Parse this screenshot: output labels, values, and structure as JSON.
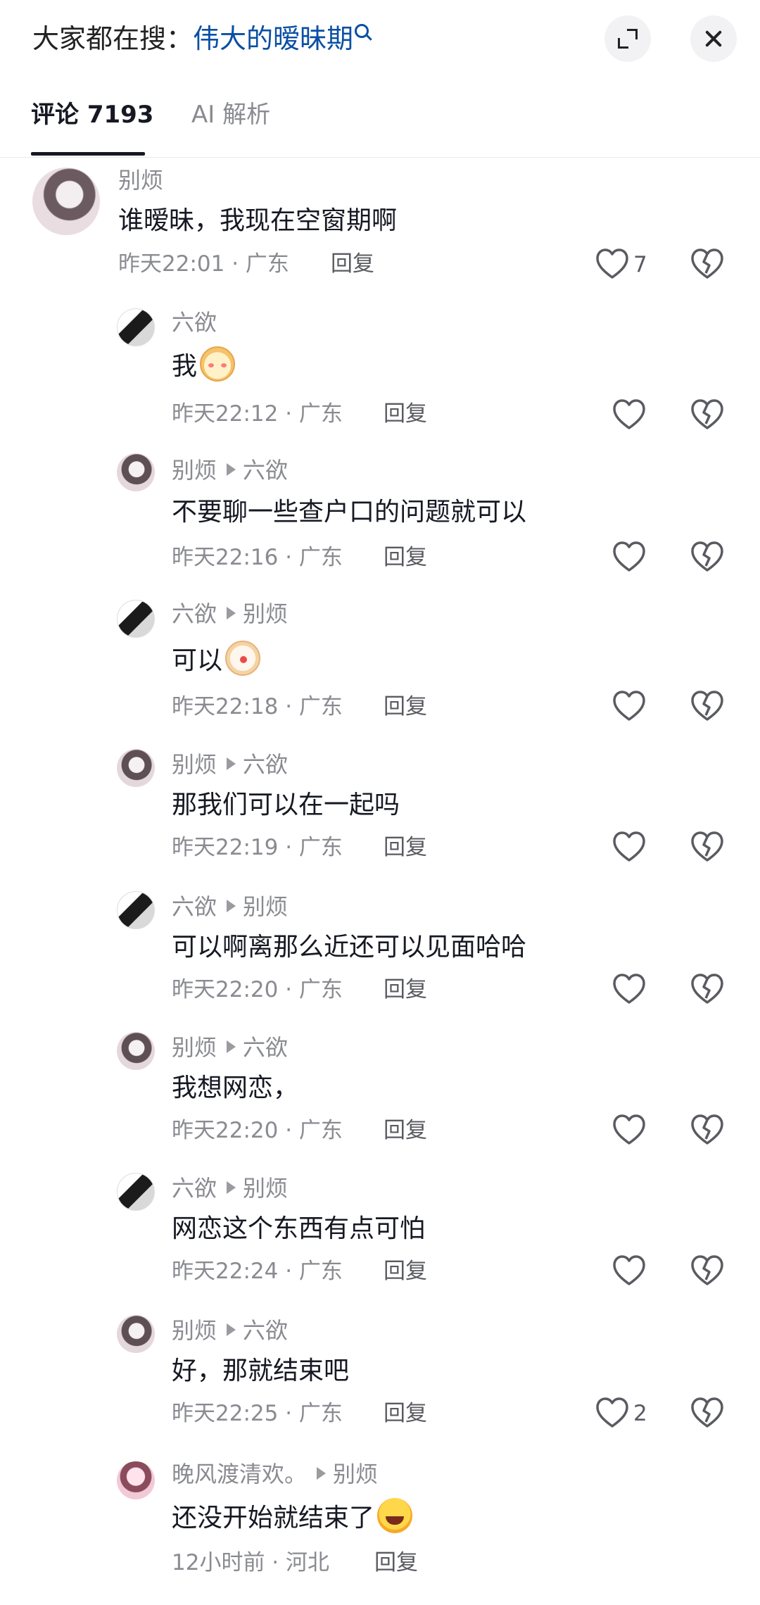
{
  "header": {
    "search_prefix": "大家都在搜：",
    "search_keyword": "伟大的暧昧期"
  },
  "tabs": [
    {
      "label": "评论 7193"
    },
    {
      "label": "AI 解析"
    }
  ],
  "comments": [
    {
      "author": "别烦",
      "reply_to": "",
      "text": "谁暧昧，我现在空窗期啊",
      "emoji": "",
      "time": "昨天22:01 · 广东",
      "reply": "回复",
      "likes": "7"
    },
    {
      "author": "六欲",
      "reply_to": "",
      "text": "我",
      "emoji": "shy-emoji",
      "time": "昨天22:12 · 广东",
      "reply": "回复",
      "likes": ""
    },
    {
      "author": "别烦",
      "reply_to": "六欲",
      "text": "不要聊一些查户口的问题就可以",
      "emoji": "",
      "time": "昨天22:16 · 广东",
      "reply": "回复",
      "likes": ""
    },
    {
      "author": "六欲",
      "reply_to": "别烦",
      "text": "可以",
      "emoji": "clown-emoji",
      "time": "昨天22:18 · 广东",
      "reply": "回复",
      "likes": ""
    },
    {
      "author": "别烦",
      "reply_to": "六欲",
      "text": "那我们可以在一起吗",
      "emoji": "",
      "time": "昨天22:19 · 广东",
      "reply": "回复",
      "likes": ""
    },
    {
      "author": "六欲",
      "reply_to": "别烦",
      "text": "可以啊离那么近还可以见面哈哈",
      "emoji": "",
      "time": "昨天22:20 · 广东",
      "reply": "回复",
      "likes": ""
    },
    {
      "author": "别烦",
      "reply_to": "六欲",
      "text": "我想网恋，",
      "emoji": "",
      "time": "昨天22:20 · 广东",
      "reply": "回复",
      "likes": ""
    },
    {
      "author": "六欲",
      "reply_to": "别烦",
      "text": "网恋这个东西有点可怕",
      "emoji": "",
      "time": "昨天22:24 · 广东",
      "reply": "回复",
      "likes": ""
    },
    {
      "author": "别烦",
      "reply_to": "六欲",
      "text": "好，那就结束吧",
      "emoji": "",
      "time": "昨天22:25 · 广东",
      "reply": "回复",
      "likes": "2"
    },
    {
      "author": "晚风渡清欢。",
      "reply_to": "别烦",
      "text": "还没开始就结束了",
      "emoji": "laughing-crying-emoji",
      "time": "12小时前 · 河北",
      "reply": "回复",
      "likes": ""
    }
  ],
  "colors": {
    "keyword": "#0b4fa3",
    "meta_gray": "#8a8b91",
    "text": "#161823"
  }
}
